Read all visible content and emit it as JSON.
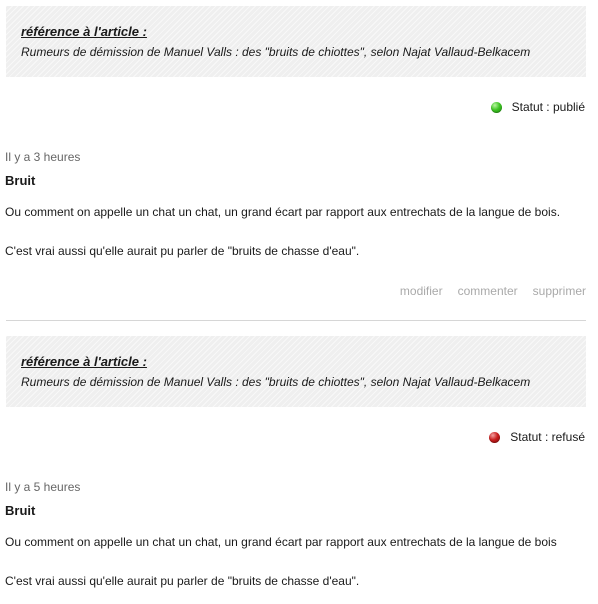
{
  "comments": [
    {
      "reference_heading": "référence à l'article :",
      "reference_title": "Rumeurs de démission de Manuel Valls : des \"bruits de chiottes\", selon Najat Vallaud-Belkacem",
      "status_label": "Statut : publié",
      "status_color": "#3fc424",
      "status_icon": "green-status-dot",
      "time_ago": "Il y a 3 heures",
      "title": "Bruit",
      "paragraphs": [
        "Ou comment on appelle un chat un chat, un grand écart par rapport aux entrechats de la langue de bois.",
        "C'est vrai aussi qu'elle aurait pu parler de \"bruits de chasse d'eau\"."
      ],
      "actions": {
        "edit": "modifier",
        "comment": "commenter",
        "delete": "supprimer"
      }
    },
    {
      "reference_heading": "référence à l'article :",
      "reference_title": "Rumeurs de démission de Manuel Valls : des \"bruits de chiottes\", selon Najat Vallaud-Belkacem",
      "status_label": "Statut : refusé",
      "status_color": "#c81e1e",
      "status_icon": "red-status-dot",
      "time_ago": "Il y a 5 heures",
      "title": "Bruit",
      "paragraphs": [
        "Ou comment on appelle un chat un chat, un grand écart par rapport aux entrechats de la langue de bois",
        "C'est vrai aussi qu'elle aurait pu parler de \"bruits de chasse d'eau\"."
      ]
    }
  ]
}
